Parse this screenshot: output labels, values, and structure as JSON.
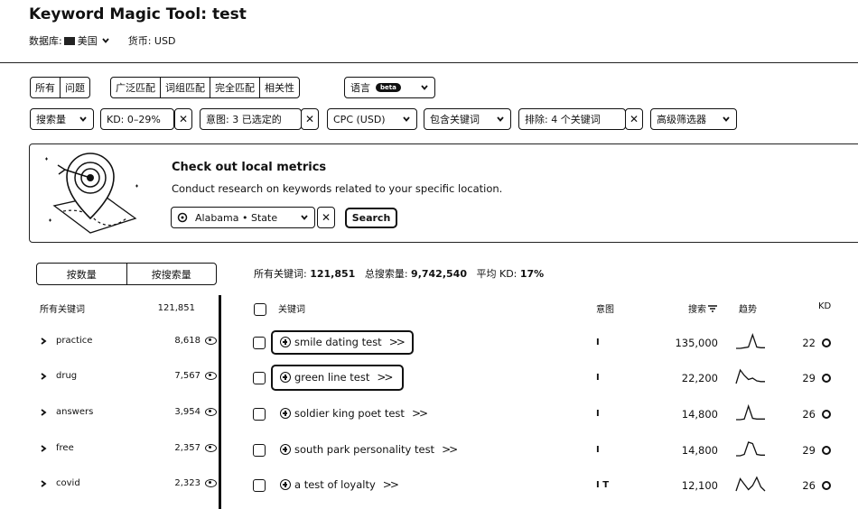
{
  "header": {
    "title": "Keyword Magic Tool:  test",
    "database_label": "数据库:",
    "database_value": "美国",
    "currency_label": "货币: USD"
  },
  "match_tabs": [
    "所有",
    "问题"
  ],
  "match_types": [
    "广泛匹配",
    "词组匹配",
    "完全匹配",
    "相关性"
  ],
  "language": {
    "label": "语言",
    "badge": "beta"
  },
  "filters": {
    "volume": "搜索量",
    "kd": "KD: 0–29%",
    "intent": "意图: 3 已选定的",
    "cpc": "CPC (USD)",
    "include": "包含关键词",
    "exclude": "排除:  4 个关键词",
    "advanced": "高级筛选器"
  },
  "promo": {
    "title": "Check out local metrics",
    "subtitle": "Conduct research on keywords related to your specific location.",
    "location": "Alabama • State",
    "search_button": "Search"
  },
  "toggle": {
    "by_count": "按数量",
    "by_volume": "按搜索量"
  },
  "stats": {
    "all_keywords_label": "所有关键词:",
    "all_keywords_value": "121,851",
    "total_volume_label": "总搜索量:",
    "total_volume_value": "9,742,540",
    "avg_kd_label": "平均 KD:",
    "avg_kd_value": "17%"
  },
  "sidebar": {
    "header_label": "所有关键词",
    "header_count": "121,851",
    "items": [
      {
        "label": "practice",
        "count": "8,618"
      },
      {
        "label": "drug",
        "count": "7,567"
      },
      {
        "label": "answers",
        "count": "3,954"
      },
      {
        "label": "free",
        "count": "2,357"
      },
      {
        "label": "covid",
        "count": "2,323"
      }
    ]
  },
  "table": {
    "headers": {
      "keyword": "关键词",
      "intent": "意图",
      "volume": "搜索",
      "trend": "趋势",
      "kd": "KD"
    },
    "rows": [
      {
        "keyword": "smile dating test",
        "intent": "I",
        "volume": "135,000",
        "kd": "22",
        "trend": [
          0,
          0,
          0.05,
          0.1,
          1,
          0.1,
          0.05,
          0.05
        ]
      },
      {
        "keyword": "green line test",
        "intent": "I",
        "volume": "22,200",
        "kd": "29",
        "trend": [
          0,
          1,
          0.6,
          0.3,
          0.4,
          0.2,
          0.15,
          0.15
        ]
      },
      {
        "keyword": "soldier king poet test",
        "intent": "I",
        "volume": "14,800",
        "kd": "26",
        "trend": [
          0,
          0,
          0.05,
          1,
          0.1,
          0.05,
          0.05,
          0.05
        ]
      },
      {
        "keyword": "south park personality test",
        "intent": "I",
        "volume": "14,800",
        "kd": "29",
        "trend": [
          0,
          0,
          0.1,
          1,
          0.9,
          0.1,
          0.05,
          0.05
        ]
      },
      {
        "keyword": "a test of loyalty",
        "intent": "I  T",
        "volume": "12,100",
        "kd": "26",
        "trend": [
          0,
          0.9,
          0.5,
          0.1,
          0.4,
          1,
          0.3,
          0
        ]
      }
    ]
  }
}
